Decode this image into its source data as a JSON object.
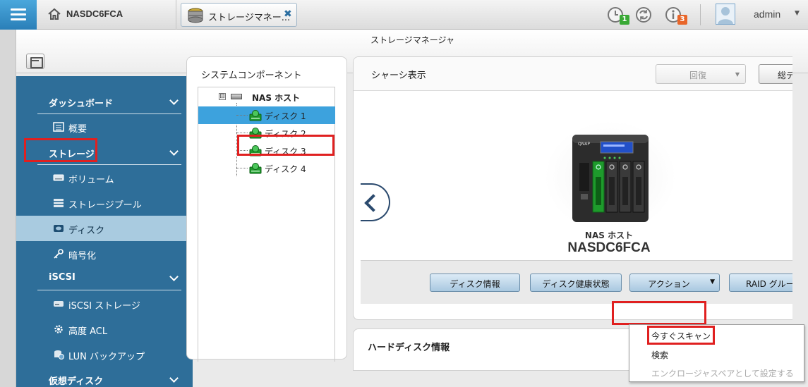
{
  "topbar": {
    "host_name": "NASDC6FCA",
    "app_tab_label": "ストレージマネー...",
    "notifications": [
      {
        "icon": "clock-icon",
        "count": "1",
        "color": "#39a935"
      },
      {
        "icon": "sync-icon",
        "count": ""
      },
      {
        "icon": "info-icon",
        "count": "3",
        "color": "#e8662a"
      }
    ],
    "user": "admin"
  },
  "window": {
    "title": "ストレージマネージャ"
  },
  "sidebar": {
    "sections": [
      {
        "label": "ダッシュボード",
        "items": [
          {
            "label": "概要",
            "icon": "overview-icon"
          }
        ]
      },
      {
        "label": "ストレージ",
        "items": [
          {
            "label": "ボリューム",
            "icon": "volume-icon"
          },
          {
            "label": "ストレージプール",
            "icon": "storage-pool-icon"
          },
          {
            "label": "ディスク",
            "icon": "disk-icon",
            "active": true
          },
          {
            "label": "暗号化",
            "icon": "key-icon"
          }
        ]
      },
      {
        "label": "iSCSI",
        "items": [
          {
            "label": "iSCSI ストレージ",
            "icon": "iscsi-storage-icon"
          },
          {
            "label": "高度 ACL",
            "icon": "gear-icon"
          },
          {
            "label": "LUN バックアップ",
            "icon": "lun-backup-icon"
          }
        ]
      },
      {
        "label": "仮想ディスク",
        "items": []
      }
    ]
  },
  "tree": {
    "title": "システムコンポーネント",
    "expand_symbol": "⊟",
    "host": "NAS ホスト",
    "disks": [
      "ディスク 1",
      "ディスク 2",
      "ディスク 3",
      "ディスク 4"
    ],
    "selected_index": 0
  },
  "chassis": {
    "title": "シャーシ表示",
    "restore_label": "回復",
    "summary_label": "総デ",
    "nas_label": "NAS ホスト",
    "nas_name": "NASDC6FCA",
    "buttons": {
      "disk_info": "ディスク情報",
      "disk_health": "ディスク健康状態",
      "action": "アクション",
      "raid_group": "RAID グループ"
    }
  },
  "hdd_info": {
    "title": "ハードディスク情報"
  },
  "action_menu": {
    "items": [
      {
        "label": "今すぐスキャン",
        "enabled": true
      },
      {
        "label": "検索",
        "enabled": true
      },
      {
        "label": "エンクロージャスペアとして設定する",
        "enabled": false
      }
    ]
  },
  "colors": {
    "sidebar_bg": "#2e6e99",
    "sidebar_active": "#a9cbe0",
    "tree_selected": "#3da2dd",
    "highlight": "#e02020",
    "disk_green": "#1e9b2c"
  }
}
